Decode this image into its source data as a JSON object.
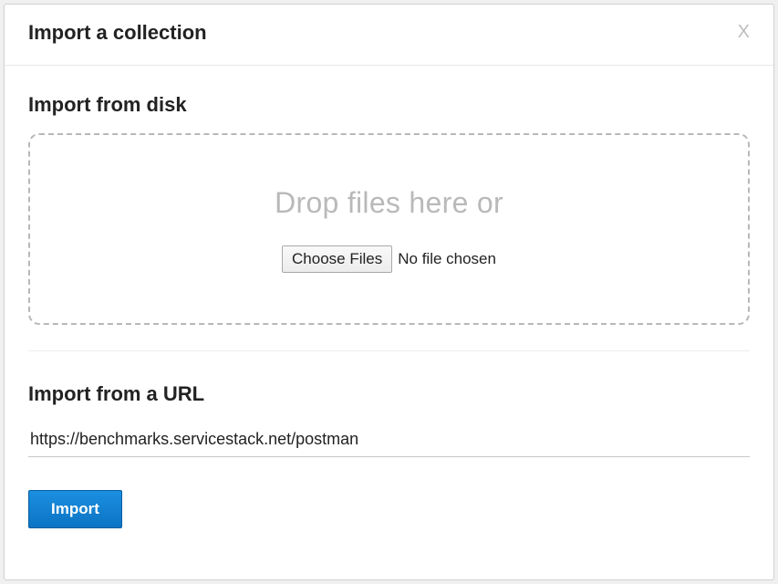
{
  "modal": {
    "title": "Import a collection",
    "close_label": "X"
  },
  "disk": {
    "heading": "Import from disk",
    "drop_text": "Drop files here or",
    "choose_label": "Choose Files",
    "file_status": "No file chosen"
  },
  "url": {
    "heading": "Import from a URL",
    "value": "https://benchmarks.servicestack.net/postman"
  },
  "actions": {
    "import_label": "Import"
  }
}
